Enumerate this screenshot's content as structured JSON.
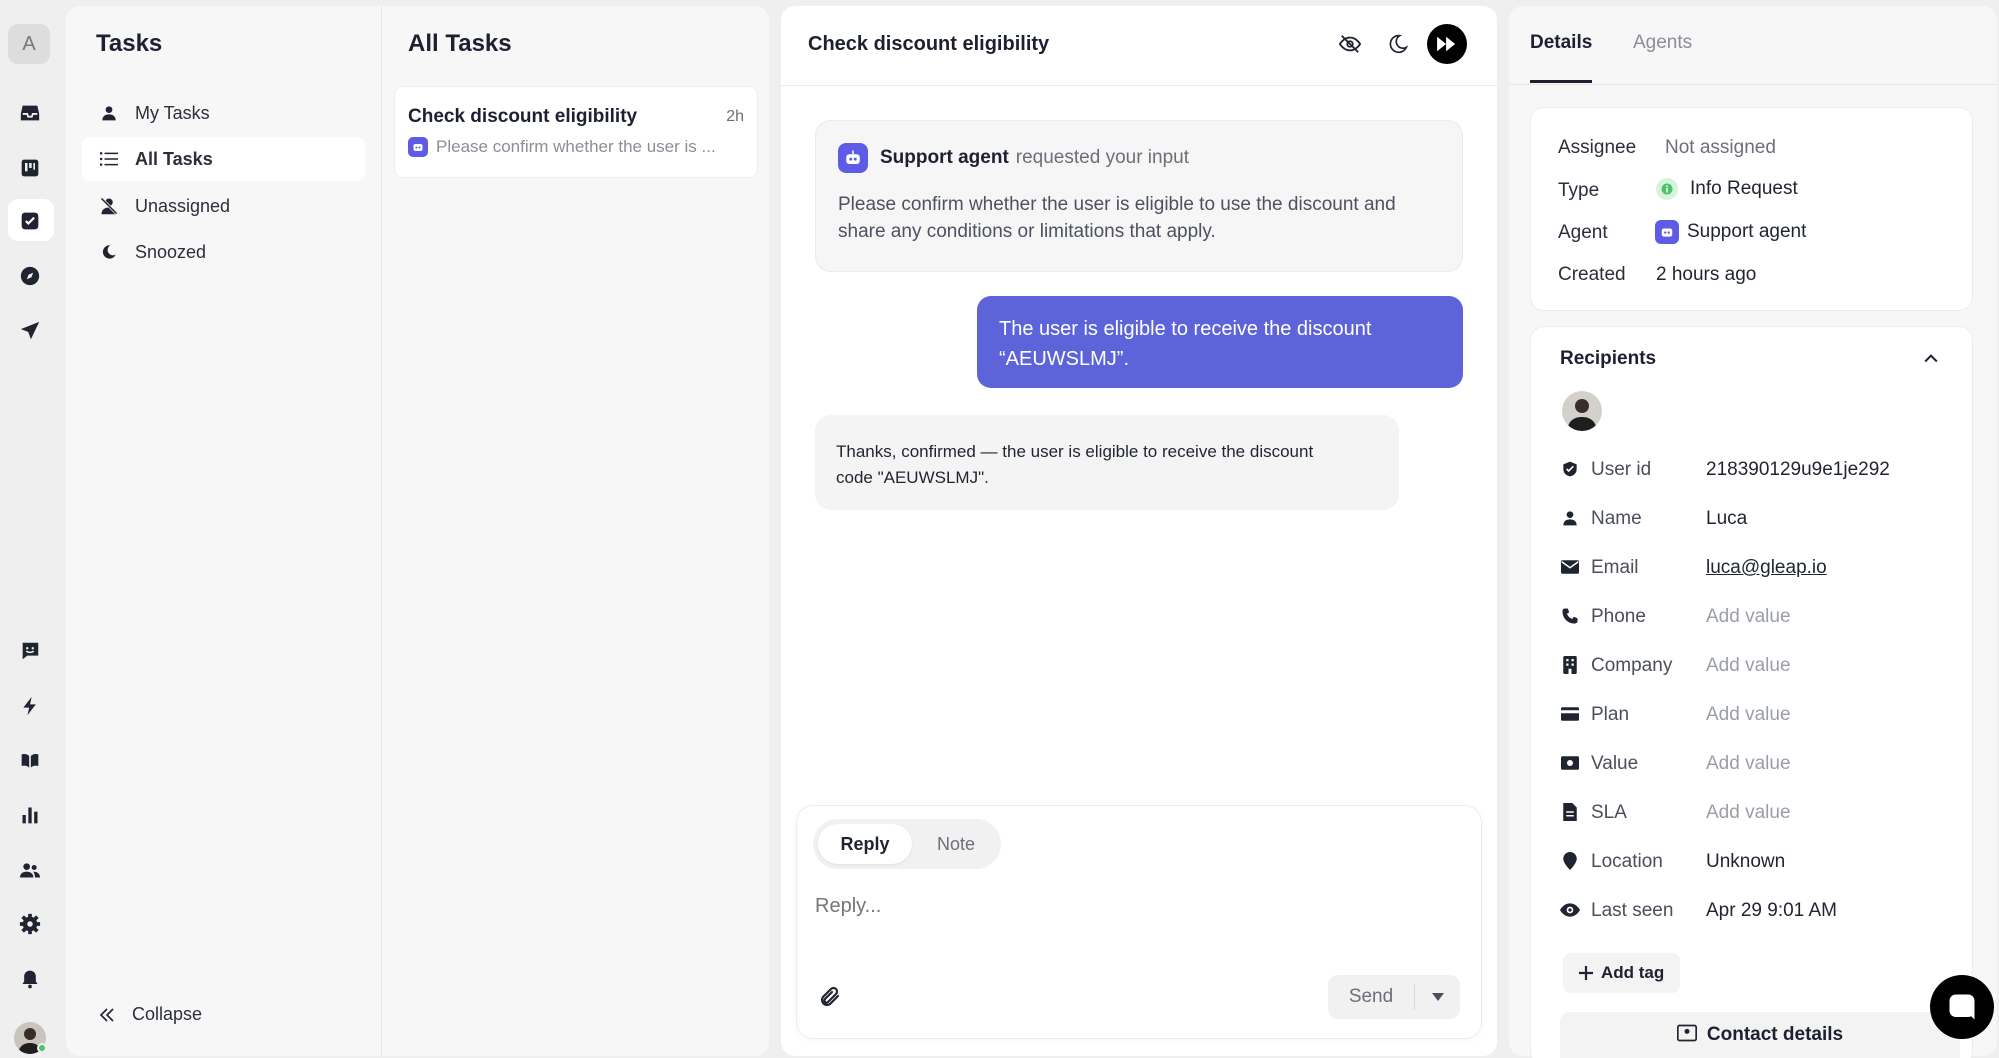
{
  "rail": {
    "workspace_initial": "A",
    "icons": [
      "inbox-icon",
      "board-icon",
      "tasks-icon",
      "explore-icon",
      "send-icon",
      "feedback-icon",
      "bolt-icon",
      "book-icon",
      "chart-icon",
      "people-icon",
      "gear-icon",
      "bell-icon",
      "avatar"
    ]
  },
  "tasks_nav": {
    "title": "Tasks",
    "items": [
      {
        "label": "My Tasks",
        "icon": "person-icon"
      },
      {
        "label": "All Tasks",
        "icon": "list-icon",
        "active": true
      },
      {
        "label": "Unassigned",
        "icon": "person-off-icon"
      },
      {
        "label": "Snoozed",
        "icon": "moon-icon"
      }
    ],
    "collapse_label": "Collapse"
  },
  "task_list": {
    "title": "All Tasks",
    "items": [
      {
        "title": "Check discount eligibility",
        "age": "2h",
        "preview": "Please confirm whether the user is ..."
      }
    ]
  },
  "chat": {
    "title": "Check discount eligibility",
    "request": {
      "agent_name": "Support agent",
      "action": "requested your input",
      "text_line1": "Please confirm whether the user is eligible to use the discount and",
      "text_line2": "share any conditions or limitations that apply."
    },
    "user_reply": {
      "line1": "The user is eligible to receive the discount",
      "line2": "“AEUWSLMJ”."
    },
    "bot_reply": {
      "line1": "Thanks, confirmed — the user is eligible to receive the discount",
      "line2": "code \"AEUWSLMJ\"."
    },
    "composer": {
      "tab_reply": "Reply",
      "tab_note": "Note",
      "placeholder": "Reply...",
      "send_label": "Send"
    }
  },
  "details": {
    "tabs": [
      "Details",
      "Agents"
    ],
    "assignee_label": "Assignee",
    "assignee_value": "Not assigned",
    "type_label": "Type",
    "type_value": "Info Request",
    "agent_label": "Agent",
    "agent_value": "Support agent",
    "created_label": "Created",
    "created_value": "2 hours ago",
    "recipients_title": "Recipients",
    "fields": [
      {
        "label": "User id",
        "value": "218390129u9e1je292",
        "icon": "shield-icon"
      },
      {
        "label": "Name",
        "value": "Luca",
        "icon": "person-icon"
      },
      {
        "label": "Email",
        "value": "luca@gleap.io",
        "icon": "mail-icon"
      },
      {
        "label": "Phone",
        "value": "Add value",
        "icon": "phone-icon"
      },
      {
        "label": "Company",
        "value": "Add value",
        "icon": "building-icon"
      },
      {
        "label": "Plan",
        "value": "Add value",
        "icon": "card-icon"
      },
      {
        "label": "Value",
        "value": "Add value",
        "icon": "money-icon"
      },
      {
        "label": "SLA",
        "value": "Add value",
        "icon": "document-icon"
      },
      {
        "label": "Location",
        "value": "Unknown",
        "icon": "pin-icon"
      },
      {
        "label": "Last seen",
        "value": "Apr 29 9:01 AM",
        "icon": "eye-icon"
      }
    ],
    "add_tag_label": "Add tag",
    "contact_details_label": "Contact details"
  },
  "colors": {
    "accent": "#5d63d9",
    "status_green": "#4cc36a",
    "background": "#efefef"
  }
}
